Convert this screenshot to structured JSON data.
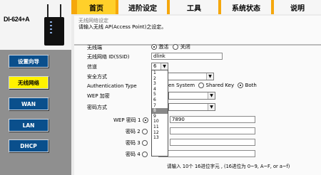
{
  "device": {
    "model": "DI-624+A"
  },
  "sidebar": {
    "items": [
      {
        "label": "设置向导"
      },
      {
        "label": "无线网络"
      },
      {
        "label": "WAN"
      },
      {
        "label": "LAN"
      },
      {
        "label": "DHCP"
      }
    ]
  },
  "tabs": [
    {
      "label": "首页"
    },
    {
      "label": "进阶设定"
    },
    {
      "label": "工具"
    },
    {
      "label": "系统状态"
    },
    {
      "label": "说明"
    }
  ],
  "form": {
    "section_title": "无线网络设定",
    "subtitle": "请输入无线 AP(Access Point)之设定。",
    "wireless": {
      "label": "无线端",
      "on": "激活",
      "off": "关闭"
    },
    "ssid": {
      "label": "无线网络 ID(SSID)",
      "value": "dlink"
    },
    "channel": {
      "label": "信道",
      "value": "6"
    },
    "security": {
      "label": "安全方式"
    },
    "auth": {
      "label": "Authentication Type",
      "opt1": "en System",
      "opt2": "Shared Key",
      "opt3": "Both"
    },
    "wep": {
      "label": "WEP 加密"
    },
    "key_type": {
      "label": "密码方式"
    },
    "keys": [
      {
        "label": "WEP 密码",
        "num": "1",
        "value": "7890"
      },
      {
        "label": "密码",
        "num": "2",
        "value": ""
      },
      {
        "label": "密码",
        "num": "3",
        "value": ""
      },
      {
        "label": "密码",
        "num": "4",
        "value": ""
      }
    ],
    "hint": "请输入 10个 16进位字元 , (16进位为 0~9, A~F, or a~f)"
  },
  "channel_options": [
    "1",
    "2",
    "3",
    "4",
    "5",
    "6",
    "7",
    "8",
    "9",
    "10",
    "11",
    "12",
    "13"
  ],
  "channel_highlighted": "8"
}
